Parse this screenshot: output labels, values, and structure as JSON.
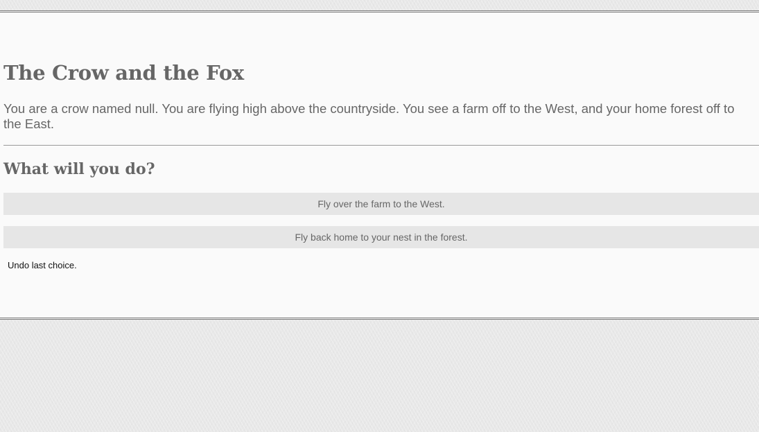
{
  "story": {
    "title": "The Crow and the Fox",
    "passage": "You are a crow named null. You are flying high above the countryside. You see a farm off to the West, and your home forest off to the East."
  },
  "choices": {
    "heading": "What will you do?",
    "options": [
      {
        "label": "Fly over the farm to the West."
      },
      {
        "label": "Fly back home to your nest in the forest."
      }
    ],
    "undo_label": "Undo last choice."
  },
  "colors": {
    "background": "#e8e8e8",
    "panel": "#fafafa",
    "text": "#666666",
    "button": "#e6e6e6"
  }
}
